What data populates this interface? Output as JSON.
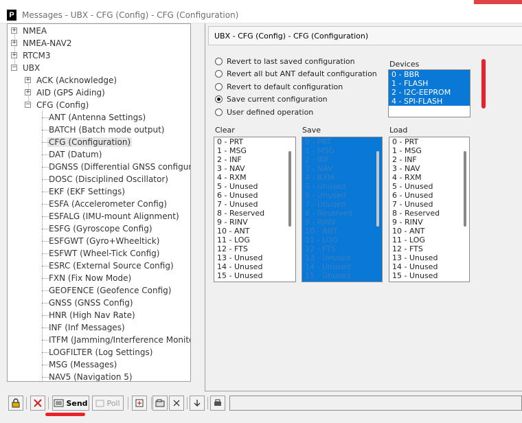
{
  "window": {
    "title": "Messages - UBX - CFG (Config) - CFG (Configuration)",
    "app_icon": "P"
  },
  "tree": {
    "nodes": [
      {
        "label": "NMEA",
        "level": 0,
        "expander": "+"
      },
      {
        "label": "NMEA-NAV2",
        "level": 0,
        "expander": "+"
      },
      {
        "label": "RTCM3",
        "level": 0,
        "expander": "+"
      },
      {
        "label": "UBX",
        "level": 0,
        "expander": "-"
      },
      {
        "label": "ACK (Acknowledge)",
        "level": 1,
        "expander": "+"
      },
      {
        "label": "AID (GPS Aiding)",
        "level": 1,
        "expander": "+"
      },
      {
        "label": "CFG (Config)",
        "level": 1,
        "expander": "-"
      },
      {
        "label": "ANT (Antenna Settings)",
        "level": 2
      },
      {
        "label": "BATCH (Batch mode output)",
        "level": 2
      },
      {
        "label": "CFG (Configuration)",
        "level": 2,
        "selected": true
      },
      {
        "label": "DAT (Datum)",
        "level": 2
      },
      {
        "label": "DGNSS (Differential GNSS configuration)",
        "level": 2
      },
      {
        "label": "DOSC (Disciplined Oscillator)",
        "level": 2
      },
      {
        "label": "EKF (EKF Settings)",
        "level": 2
      },
      {
        "label": "ESFA (Accelerometer Config)",
        "level": 2
      },
      {
        "label": "ESFALG (IMU-mount Alignment)",
        "level": 2
      },
      {
        "label": "ESFG (Gyroscope Config)",
        "level": 2
      },
      {
        "label": "ESFGWT (Gyro+Wheeltick)",
        "level": 2
      },
      {
        "label": "ESFWT (Wheel-Tick Config)",
        "level": 2
      },
      {
        "label": "ESRC (External Source Config)",
        "level": 2
      },
      {
        "label": "FXN (Fix Now Mode)",
        "level": 2
      },
      {
        "label": "GEOFENCE (Geofence Config)",
        "level": 2
      },
      {
        "label": "GNSS (GNSS Config)",
        "level": 2
      },
      {
        "label": "HNR (High Nav Rate)",
        "level": 2
      },
      {
        "label": "INF (Inf Messages)",
        "level": 2
      },
      {
        "label": "ITFM (Jamming/Interference Monitor)",
        "level": 2
      },
      {
        "label": "LOGFILTER (Log Settings)",
        "level": 2
      },
      {
        "label": "MSG (Messages)",
        "level": 2
      },
      {
        "label": "NAV5 (Navigation 5)",
        "level": 2
      }
    ]
  },
  "panel": {
    "header": "UBX - CFG (Config) - CFG (Configuration)",
    "options": [
      {
        "label": "Revert to last saved configuration",
        "selected": false
      },
      {
        "label": "Revert all but ANT default configuration",
        "selected": false
      },
      {
        "label": "Revert to default configuration",
        "selected": false
      },
      {
        "label": "Save current configuration",
        "selected": true
      },
      {
        "label": "User defined operation",
        "selected": false
      }
    ],
    "devices": {
      "label": "Devices",
      "items": [
        "0 - BBR",
        "1 - FLASH",
        "2 - I2C-EEPROM",
        "4 - SPI-FLASH"
      ]
    },
    "clear_label": "Clear",
    "save_label": "Save",
    "load_label": "Load",
    "sections": [
      "0 - PRT",
      "1 - MSG",
      "2 - INF",
      "3 - NAV",
      "4 - RXM",
      "5 - Unused",
      "6 - Unused",
      "7 - Unused",
      "8 - Reserved",
      "9 - RINV",
      "10 - ANT",
      "11 - LOG",
      "12 - FTS",
      "13 - Unused",
      "14 - Unused",
      "15 - Unused"
    ]
  },
  "toolbar": {
    "send_label": "Send",
    "poll_label": "Poll"
  },
  "colors": {
    "selection": "#0a78d7",
    "annotation": "#e8212a"
  }
}
